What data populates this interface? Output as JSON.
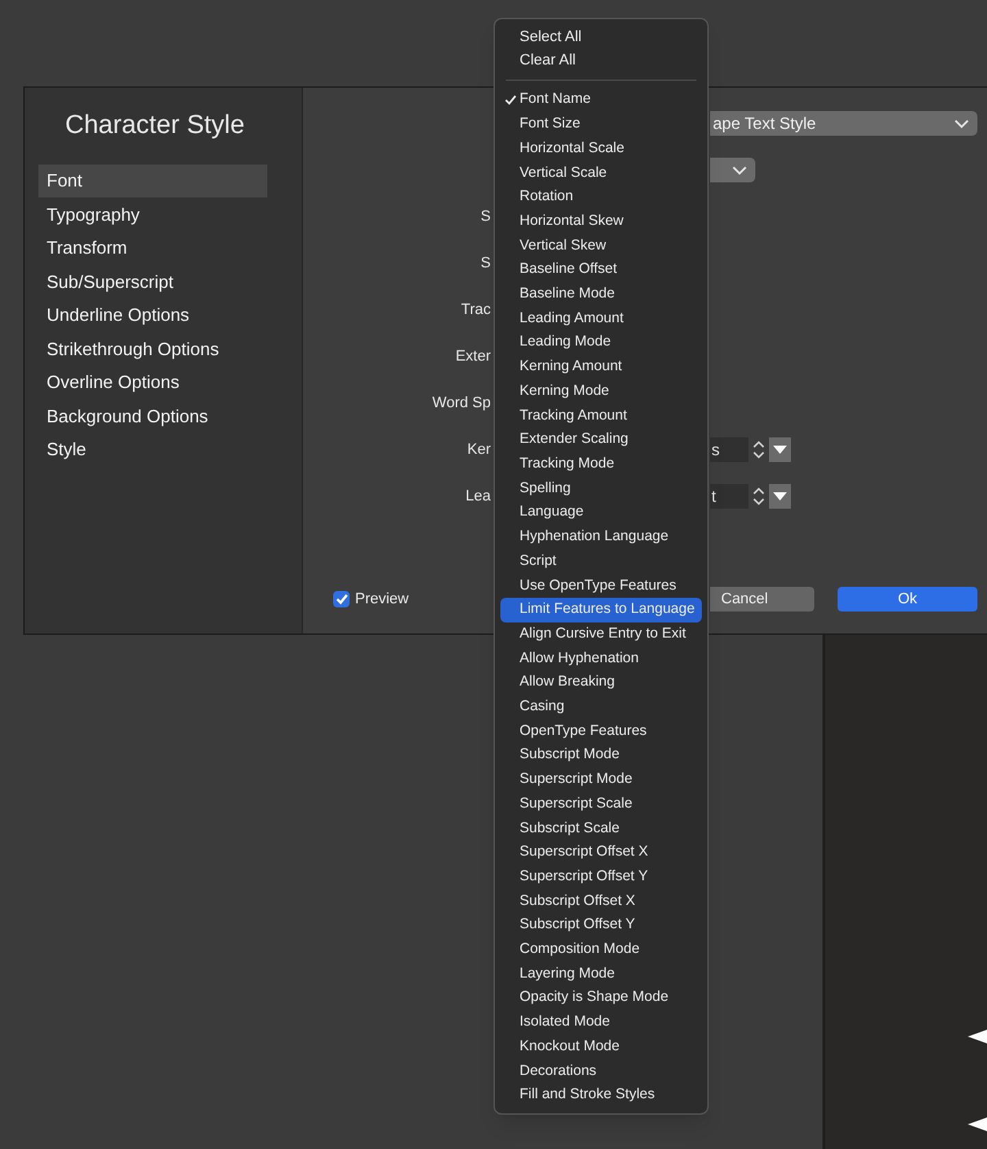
{
  "dialog": {
    "title": "Character Style",
    "sidebar": {
      "items": [
        {
          "label": "Font",
          "selected": true
        },
        {
          "label": "Typography",
          "selected": false
        },
        {
          "label": "Transform",
          "selected": false
        },
        {
          "label": "Sub/Superscript",
          "selected": false
        },
        {
          "label": "Underline Options",
          "selected": false
        },
        {
          "label": "Strikethrough Options",
          "selected": false
        },
        {
          "label": "Overline Options",
          "selected": false
        },
        {
          "label": "Background Options",
          "selected": false
        },
        {
          "label": "Style",
          "selected": false
        }
      ]
    },
    "rows": [
      {
        "control": {
          "kind": "select",
          "value": "ape Text Style"
        }
      },
      {
        "control": {
          "kind": "select-small"
        }
      },
      {
        "label": "S"
      },
      {
        "label": "S"
      },
      {
        "label": "Trac"
      },
      {
        "label": "Exter"
      },
      {
        "label": "Word Sp"
      },
      {
        "label": "Ker",
        "control": {
          "kind": "stepper",
          "value": "s"
        }
      },
      {
        "label": "Lea",
        "control": {
          "kind": "stepper",
          "value": "t"
        }
      }
    ],
    "preview": {
      "label": "Preview",
      "checked": true
    },
    "buttons": [
      {
        "label": "Cancel",
        "kind": "secondary"
      },
      {
        "label": "Ok",
        "kind": "primary"
      }
    ]
  },
  "menu": {
    "top_items": [
      {
        "label": "Select All"
      },
      {
        "label": "Clear All"
      }
    ],
    "items": [
      {
        "label": "Font Name",
        "checked": true,
        "selected": false
      },
      {
        "label": "Font Size",
        "checked": false,
        "selected": false
      },
      {
        "label": "Horizontal Scale",
        "checked": false,
        "selected": false
      },
      {
        "label": "Vertical Scale",
        "checked": false,
        "selected": false
      },
      {
        "label": "Rotation",
        "checked": false,
        "selected": false
      },
      {
        "label": "Horizontal Skew",
        "checked": false,
        "selected": false
      },
      {
        "label": "Vertical Skew",
        "checked": false,
        "selected": false
      },
      {
        "label": "Baseline Offset",
        "checked": false,
        "selected": false
      },
      {
        "label": "Baseline Mode",
        "checked": false,
        "selected": false
      },
      {
        "label": "Leading Amount",
        "checked": false,
        "selected": false
      },
      {
        "label": "Leading Mode",
        "checked": false,
        "selected": false
      },
      {
        "label": "Kerning Amount",
        "checked": false,
        "selected": false
      },
      {
        "label": "Kerning Mode",
        "checked": false,
        "selected": false
      },
      {
        "label": "Tracking Amount",
        "checked": false,
        "selected": false
      },
      {
        "label": "Extender Scaling",
        "checked": false,
        "selected": false
      },
      {
        "label": "Tracking Mode",
        "checked": false,
        "selected": false
      },
      {
        "label": "Spelling",
        "checked": false,
        "selected": false
      },
      {
        "label": "Language",
        "checked": false,
        "selected": false
      },
      {
        "label": "Hyphenation Language",
        "checked": false,
        "selected": false
      },
      {
        "label": "Script",
        "checked": false,
        "selected": false
      },
      {
        "label": "Use OpenType Features",
        "checked": false,
        "selected": false
      },
      {
        "label": "Limit Features to Language",
        "checked": false,
        "selected": true
      },
      {
        "label": "Align Cursive Entry to Exit",
        "checked": false,
        "selected": false
      },
      {
        "label": "Allow Hyphenation",
        "checked": false,
        "selected": false
      },
      {
        "label": "Allow Breaking",
        "checked": false,
        "selected": false
      },
      {
        "label": "Casing",
        "checked": false,
        "selected": false
      },
      {
        "label": "OpenType Features",
        "checked": false,
        "selected": false
      },
      {
        "label": "Subscript Mode",
        "checked": false,
        "selected": false
      },
      {
        "label": "Superscript Mode",
        "checked": false,
        "selected": false
      },
      {
        "label": "Superscript Scale",
        "checked": false,
        "selected": false
      },
      {
        "label": "Subscript Scale",
        "checked": false,
        "selected": false
      },
      {
        "label": "Superscript Offset X",
        "checked": false,
        "selected": false
      },
      {
        "label": "Superscript Offset Y",
        "checked": false,
        "selected": false
      },
      {
        "label": "Subscript Offset X",
        "checked": false,
        "selected": false
      },
      {
        "label": "Subscript Offset Y",
        "checked": false,
        "selected": false
      },
      {
        "label": "Composition Mode",
        "checked": false,
        "selected": false
      },
      {
        "label": "Layering Mode",
        "checked": false,
        "selected": false
      },
      {
        "label": "Opacity is Shape Mode",
        "checked": false,
        "selected": false
      },
      {
        "label": "Isolated Mode",
        "checked": false,
        "selected": false
      },
      {
        "label": "Knockout Mode",
        "checked": false,
        "selected": false
      },
      {
        "label": "Decorations",
        "checked": false,
        "selected": false
      },
      {
        "label": "Fill and Stroke Styles",
        "checked": false,
        "selected": false
      }
    ]
  }
}
